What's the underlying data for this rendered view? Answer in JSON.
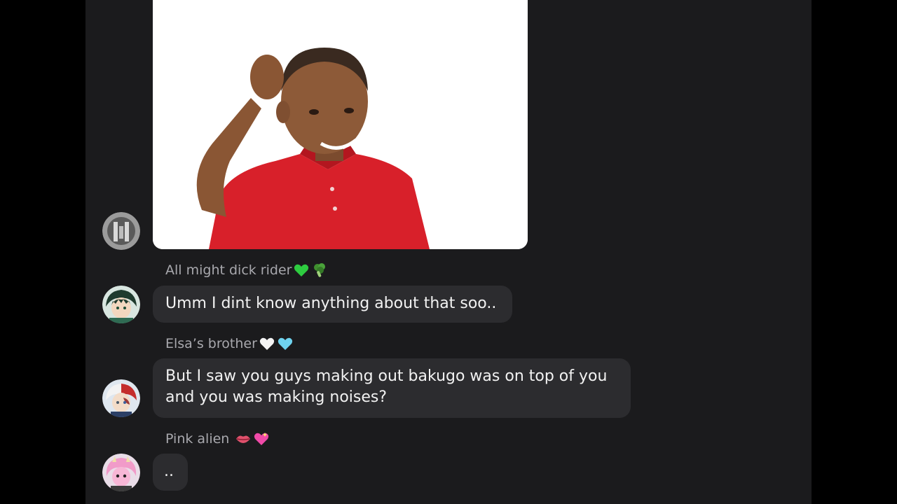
{
  "messages": [
    {
      "sender": "",
      "type": "image",
      "image": {
        "description_icon": "meme-boy-scratching-head",
        "shirt_color": "#d8202a",
        "background_color": "#ffffff"
      },
      "avatar_icon": "gray-mecha-avatar"
    },
    {
      "sender": "All might dick rider",
      "sender_emojis": [
        "green-heart-icon",
        "broccoli-icon"
      ],
      "text": "Umm I dint know anything about that soo..",
      "avatar_icon": "green-hair-hero-avatar"
    },
    {
      "sender": "Elsa’s brother",
      "sender_emojis": [
        "white-heart-icon",
        "light-blue-heart-icon"
      ],
      "text": "But I saw you guys making out bakugo was on top of you and you was making noises?",
      "avatar_icon": "red-white-hair-avatar"
    },
    {
      "sender": "Pink alien",
      "sender_emojis": [
        "lips-icon",
        "sparkling-heart-icon"
      ],
      "text": "..",
      "avatar_icon": "pink-hair-avatar"
    }
  ],
  "colors": {
    "panel_background": "#1b1b1d",
    "bubble_background": "#2c2c2f",
    "sender_text": "#a8a8ad",
    "message_text": "#f2f2f2"
  }
}
